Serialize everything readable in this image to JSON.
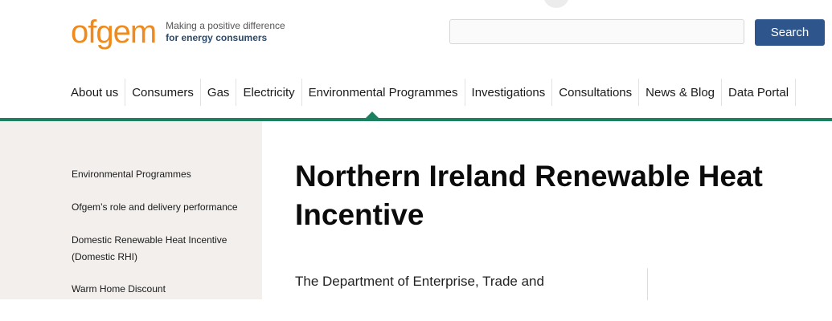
{
  "header": {
    "logo_text": "ofgem",
    "tagline_line1": "Making a positive difference",
    "tagline_line2": "for energy consumers"
  },
  "search": {
    "placeholder": "",
    "value": "",
    "button_label": "Search"
  },
  "nav": {
    "items": [
      {
        "label": "About us"
      },
      {
        "label": "Consumers"
      },
      {
        "label": "Gas"
      },
      {
        "label": "Electricity"
      },
      {
        "label": "Environmental Programmes"
      },
      {
        "label": "Investigations"
      },
      {
        "label": "Consultations"
      },
      {
        "label": "News & Blog"
      },
      {
        "label": "Data Portal"
      }
    ],
    "active_label": "Environmental Programmes"
  },
  "sidebar": {
    "items": [
      {
        "label": "Environmental Programmes"
      },
      {
        "label": "Ofgem’s role and delivery performance"
      },
      {
        "label": "Domestic Renewable Heat Incentive (Domestic RHI)"
      },
      {
        "label": "Warm Home Discount"
      }
    ]
  },
  "main": {
    "title": "Northern Ireland Renewable Heat Incentive",
    "intro": "The Department of Enterprise, Trade and"
  },
  "colors": {
    "brand_orange": "#f08a1c",
    "search_button": "#2f568c",
    "nav_rule": "#1a8060",
    "sidebar_bg": "#f2efed"
  }
}
